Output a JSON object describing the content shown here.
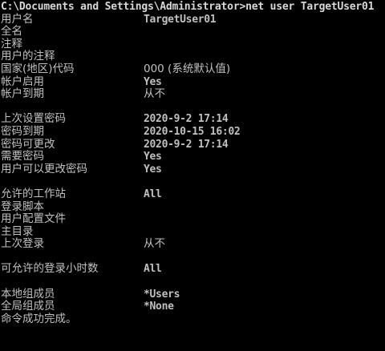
{
  "window": {
    "background": "#000000",
    "foreground": "#c0c0c0"
  },
  "command": "C:\\Documents and Settings\\Administrator>net user TargetUser01",
  "fields": [
    {
      "label": "用户名",
      "value": "TargetUser01"
    },
    {
      "label": "全名",
      "value": ""
    },
    {
      "label": "注释",
      "value": ""
    },
    {
      "label": "用户的注释",
      "value": ""
    },
    {
      "label": "国家(地区)代码",
      "value": "000 (系统默认值)"
    },
    {
      "label": "帐户启用",
      "value": "Yes"
    },
    {
      "label": "帐户到期",
      "value": "从不"
    },
    {
      "label": "",
      "value": ""
    },
    {
      "label": "上次设置密码",
      "value": "2020-9-2 17:14"
    },
    {
      "label": "密码到期",
      "value": "2020-10-15 16:02"
    },
    {
      "label": "密码可更改",
      "value": "2020-9-2 17:14"
    },
    {
      "label": "需要密码",
      "value": "Yes"
    },
    {
      "label": "用户可以更改密码",
      "value": "Yes"
    },
    {
      "label": "",
      "value": ""
    },
    {
      "label": "允许的工作站",
      "value": "All"
    },
    {
      "label": "登录脚本",
      "value": ""
    },
    {
      "label": "用户配置文件",
      "value": ""
    },
    {
      "label": "主目录",
      "value": ""
    },
    {
      "label": "上次登录",
      "value": "从不"
    },
    {
      "label": "",
      "value": ""
    },
    {
      "label": "可允许的登录小时数",
      "value": "All"
    },
    {
      "label": "",
      "value": ""
    },
    {
      "label": "本地组成员",
      "value": "*Users"
    },
    {
      "label": "全局组成员",
      "value": "*None"
    }
  ],
  "completion": "命令成功完成。"
}
